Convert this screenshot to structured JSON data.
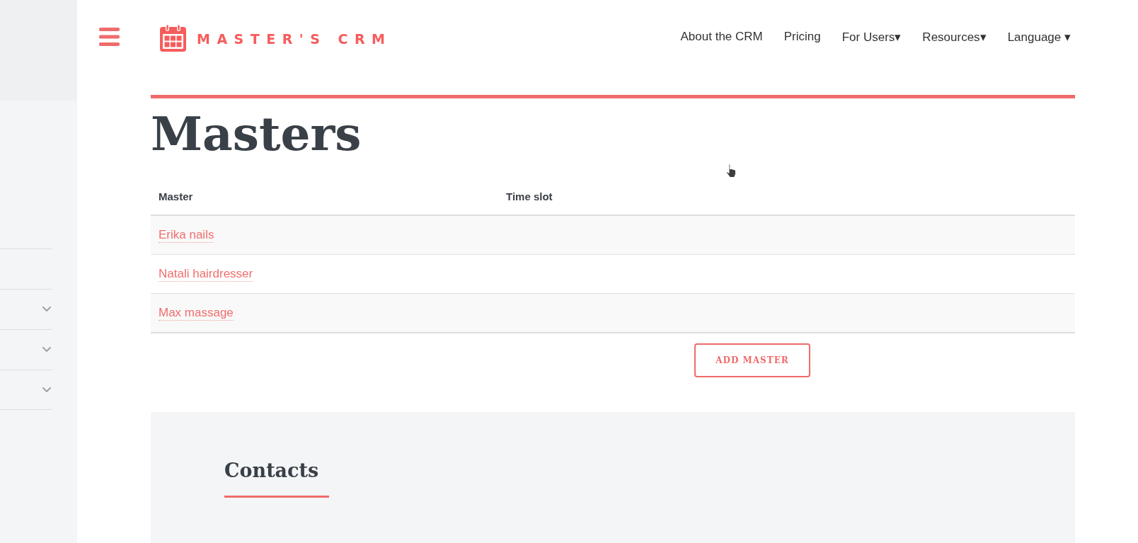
{
  "sidebar": {
    "items": [
      {
        "kind": "link"
      },
      {
        "kind": "submenu"
      },
      {
        "kind": "submenu"
      },
      {
        "kind": "submenu"
      }
    ]
  },
  "header": {
    "logo_text": "MASTER'S CRM",
    "nav": [
      "About the CRM",
      "Pricing",
      "For Users▾",
      "Resources▾",
      "Language ▾"
    ]
  },
  "page": {
    "title": "Masters"
  },
  "table": {
    "columns": [
      "Master",
      "Time slot"
    ],
    "rows": [
      {
        "master": "Erika nails"
      },
      {
        "master": "Natali hairdresser"
      },
      {
        "master": "Max massage"
      }
    ]
  },
  "add_button": {
    "label": "ADD MASTER"
  },
  "contacts": {
    "title": "Contacts"
  }
}
